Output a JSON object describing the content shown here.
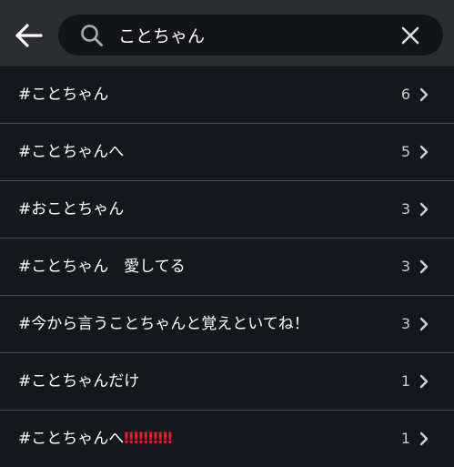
{
  "search": {
    "query": "ことちゃん"
  },
  "results": [
    {
      "tag": "#ことちゃん",
      "count": "6"
    },
    {
      "tag": "#ことちゃんへ",
      "count": "5"
    },
    {
      "tag": "#おことちゃん",
      "count": "3"
    },
    {
      "tag": "#ことちゃん　愛してる",
      "count": "3"
    },
    {
      "tag": "#今から言うことちゃんと覚えといてね！",
      "count": "3"
    },
    {
      "tag": "#ことちゃんだけ",
      "count": "1"
    },
    {
      "tag": "#ことちゃんへ",
      "tag_suffix": "‼‼‼‼‼",
      "count": "1"
    }
  ],
  "colors": {
    "topbar": "#2b2d31",
    "background": "#14171c",
    "search_box": "#121418",
    "divider": "#4a4d52",
    "emphasis_red": "#e0202a"
  },
  "icons": {
    "back": "arrow-left-icon",
    "search": "search-icon",
    "clear": "close-icon",
    "row": "chevron-right-icon"
  }
}
